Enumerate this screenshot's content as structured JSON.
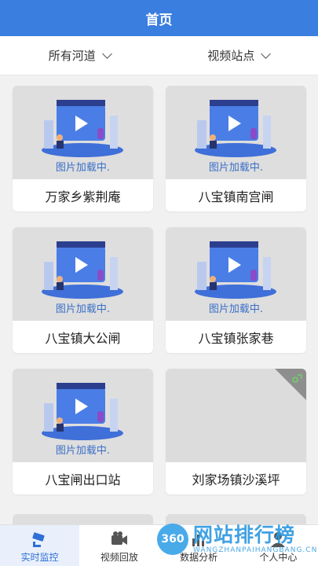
{
  "header": {
    "title": "首页"
  },
  "filters": {
    "river": "所有河道",
    "station": "视频站点"
  },
  "cards": [
    {
      "loading": "图片加载中.",
      "name": "万家乡紫荆庵"
    },
    {
      "loading": "图片加载中.",
      "name": "八宝镇南宫闸"
    },
    {
      "loading": "图片加载中.",
      "name": "八宝镇大公闸"
    },
    {
      "loading": "图片加载中.",
      "name": "八宝镇张家巷"
    },
    {
      "loading": "图片加载中.",
      "name": "八宝闸出口站"
    },
    {
      "name": "刘家场镇沙溪坪"
    }
  ],
  "tabbar": {
    "tabs": [
      {
        "label": "实时监控",
        "icon": "camera-icon"
      },
      {
        "label": "视频回放",
        "icon": "video-playback-icon"
      },
      {
        "label": "数据分析",
        "icon": "chart-icon"
      },
      {
        "label": "个人中心",
        "icon": "user-icon"
      }
    ]
  },
  "watermark": {
    "badge": "360",
    "text": "网站排行榜",
    "url": "WANGZHANPAIHANGBANG.CN"
  },
  "colors": {
    "primary": "#3a7ee0",
    "loading_text": "#3a6fc7",
    "background": "#f1f1f1"
  }
}
